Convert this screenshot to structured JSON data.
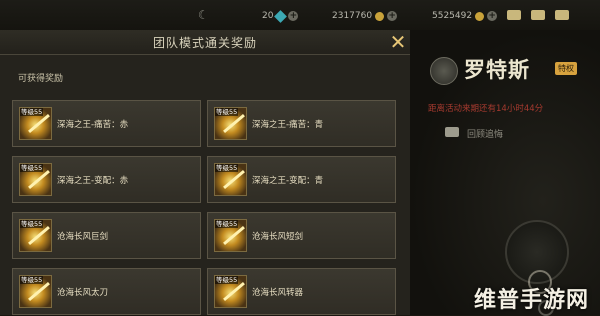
{
  "topbar": {
    "crystals": "20",
    "gold": "2317760",
    "points": "5525492"
  },
  "character": {
    "name": "罗特斯",
    "badge": "特权",
    "notice": "距离活动来期还有14小时44分",
    "option_label": "回顾追悔"
  },
  "modal": {
    "title": "团队模式通关奖励",
    "subtitle": "可获得奖励"
  },
  "rewards": [
    {
      "level": "等级55",
      "name": "深海之王-痛苦：赤"
    },
    {
      "level": "等级55",
      "name": "深海之王-痛苦：青"
    },
    {
      "level": "等级55",
      "name": "深海之王-变配：赤"
    },
    {
      "level": "等级55",
      "name": "深海之王-变配：青"
    },
    {
      "level": "等级55",
      "name": "沧海长风巨剑"
    },
    {
      "level": "等级55",
      "name": "沧海长风短剑"
    },
    {
      "level": "等级55",
      "name": "沧海长风太刀"
    },
    {
      "level": "等级55",
      "name": "沧海长风转器"
    }
  ],
  "watermark": "维普手游网",
  "icons": {
    "moon": "moon-icon",
    "close": "close-icon",
    "gem": "gem-icon",
    "coin": "coin-icon"
  },
  "colors": {
    "accent_gold": "#e8c777",
    "panel_bg": "#25231d",
    "notice_red": "#a63a2f"
  }
}
